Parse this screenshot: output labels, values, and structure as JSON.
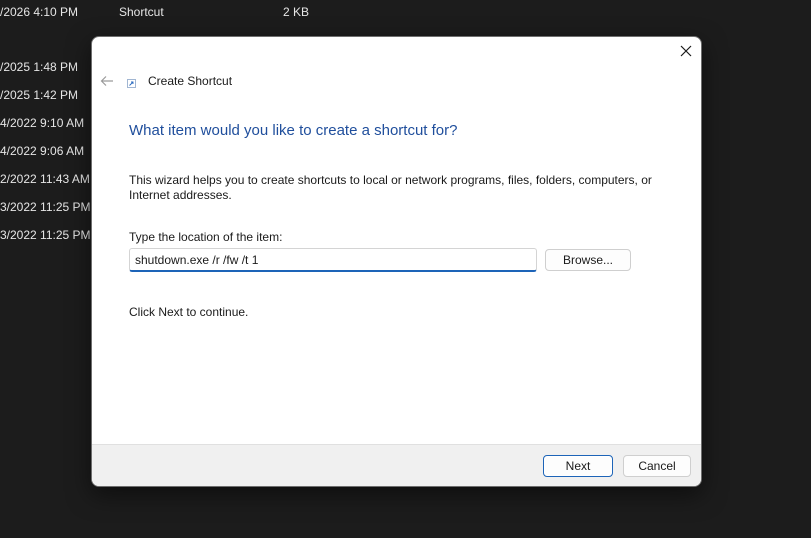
{
  "background": {
    "top_row": {
      "date": "/2026 4:10 PM",
      "type": "Shortcut",
      "size": "2 KB"
    },
    "dates": [
      "/2025 1:48 PM",
      "/2025 1:42 PM",
      "4/2022 9:10 AM",
      "4/2022 9:06 AM",
      "2/2022 11:43 AM",
      "3/2022 11:25 PM",
      "3/2022 11:25 PM"
    ]
  },
  "dialog": {
    "title": "Create Shortcut",
    "heading": "What item would you like to create a shortcut for?",
    "description": "This wizard helps you to create shortcuts to local or network programs, files, folders, computers, or Internet addresses.",
    "field_label": "Type the location of the item:",
    "location_value": "shutdown.exe /r /fw /t 1",
    "browse_label": "Browse...",
    "hint": "Click Next to continue.",
    "next_label": "Next",
    "cancel_label": "Cancel"
  },
  "colors": {
    "background": "#1c1c1c",
    "heading": "#1f4e9c",
    "accent": "#1d64b8"
  }
}
